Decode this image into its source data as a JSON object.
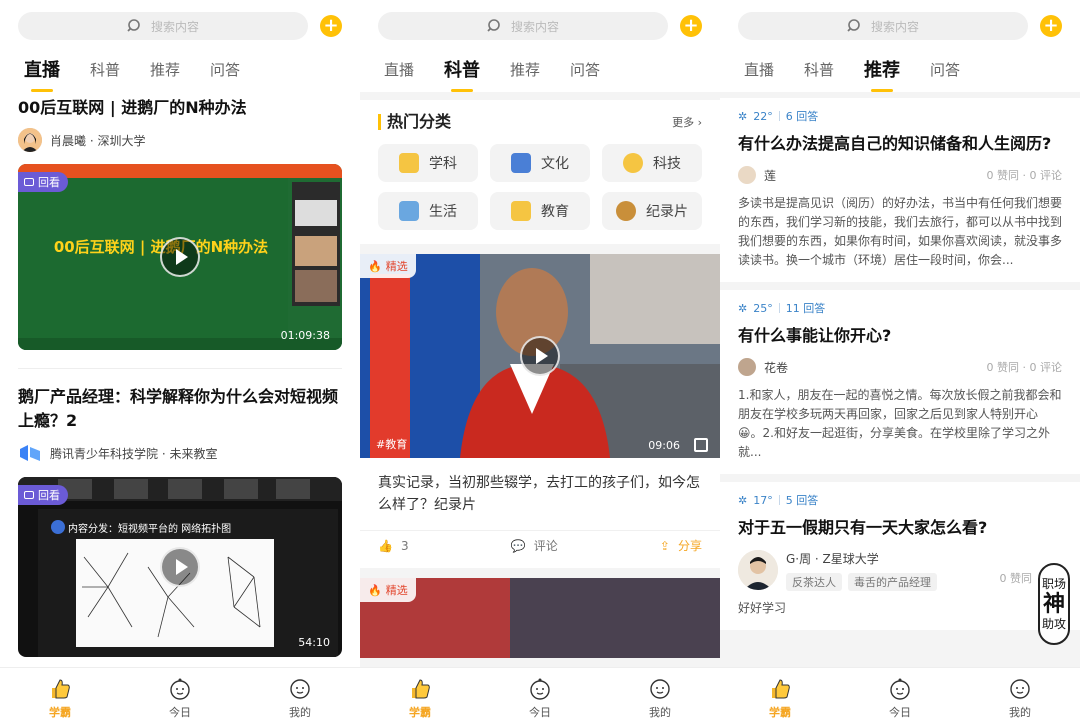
{
  "search_placeholder": "搜索内容",
  "tabs": [
    "直播",
    "科普",
    "推荐",
    "问答"
  ],
  "bottom_nav": [
    "学霸",
    "今日",
    "我的"
  ],
  "screen1": {
    "posts": [
      {
        "title": "00后互联网 | 进鹅厂的N种办法",
        "author": "肖晨曦 · 深圳大学",
        "badge": "回看",
        "video_banner": "00后互联网 | 进鹅厂的N种办法",
        "duration": "01:09:38"
      },
      {
        "title": "鹅厂产品经理：科学解释你为什么会对短视频上瘾？2",
        "author": "腾讯青少年科技学院 · 未来教室",
        "badge": "回看",
        "slide_heading": "内容分发：短视频平台的 网络拓扑图",
        "duration": "54:10"
      }
    ]
  },
  "screen2": {
    "hot_title": "热门分类",
    "more": "更多",
    "categories": [
      {
        "label": "学科",
        "color": "#f5c542"
      },
      {
        "label": "文化",
        "color": "#4a7fd6"
      },
      {
        "label": "科技",
        "color": "#f5c542"
      },
      {
        "label": "生活",
        "color": "#6aa7e0"
      },
      {
        "label": "教育",
        "color": "#f5c542"
      },
      {
        "label": "纪录片",
        "color": "#c98f3a"
      }
    ],
    "feature": {
      "tag": "精选",
      "hashtag": "#教育",
      "duration": "09:06",
      "desc": "真实记录，当初那些辍学，去打工的孩子们，如今怎么样了？纪录片",
      "likes": "3",
      "comment": "评论",
      "share": "分享"
    },
    "feature2_tag": "精选"
  },
  "screen3": {
    "questions": [
      {
        "temp": "22°",
        "answers": "6 回答",
        "title": "有什么办法提高自己的知识储备和人生阅历?",
        "user": "莲",
        "stats": "0 赞同 · 0 评论",
        "text": "多读书是提高见识（阅历）的好办法，书当中有任何我们想要的东西，我们学习新的技能，我们去旅行，都可以从书中找到我们想要的东西，如果你有时间，如果你喜欢阅读，就没事多读读书。换一个城市（环境）居住一段时间，你会..."
      },
      {
        "temp": "25°",
        "answers": "11 回答",
        "title": "有什么事能让你开心?",
        "user": "花卷",
        "stats": "0 赞同 · 0 评论",
        "text": "1.和家人，朋友在一起的喜悦之情。每次放长假之前我都会和朋友在学校多玩两天再回家，回家之后见到家人特别开心😀。2.和好友一起逛街，分享美食。在学校里除了学习之外就..."
      },
      {
        "temp": "17°",
        "answers": "5 回答",
        "title": "对于五一假期只有一天大家怎么看?",
        "user": "G·周 · Z星球大学",
        "tags": [
          "反茶达人",
          "毒舌的产品经理"
        ],
        "stats": "0 赞同",
        "text": "好好学习"
      }
    ],
    "seal": [
      "职场",
      "神",
      "助攻"
    ]
  }
}
